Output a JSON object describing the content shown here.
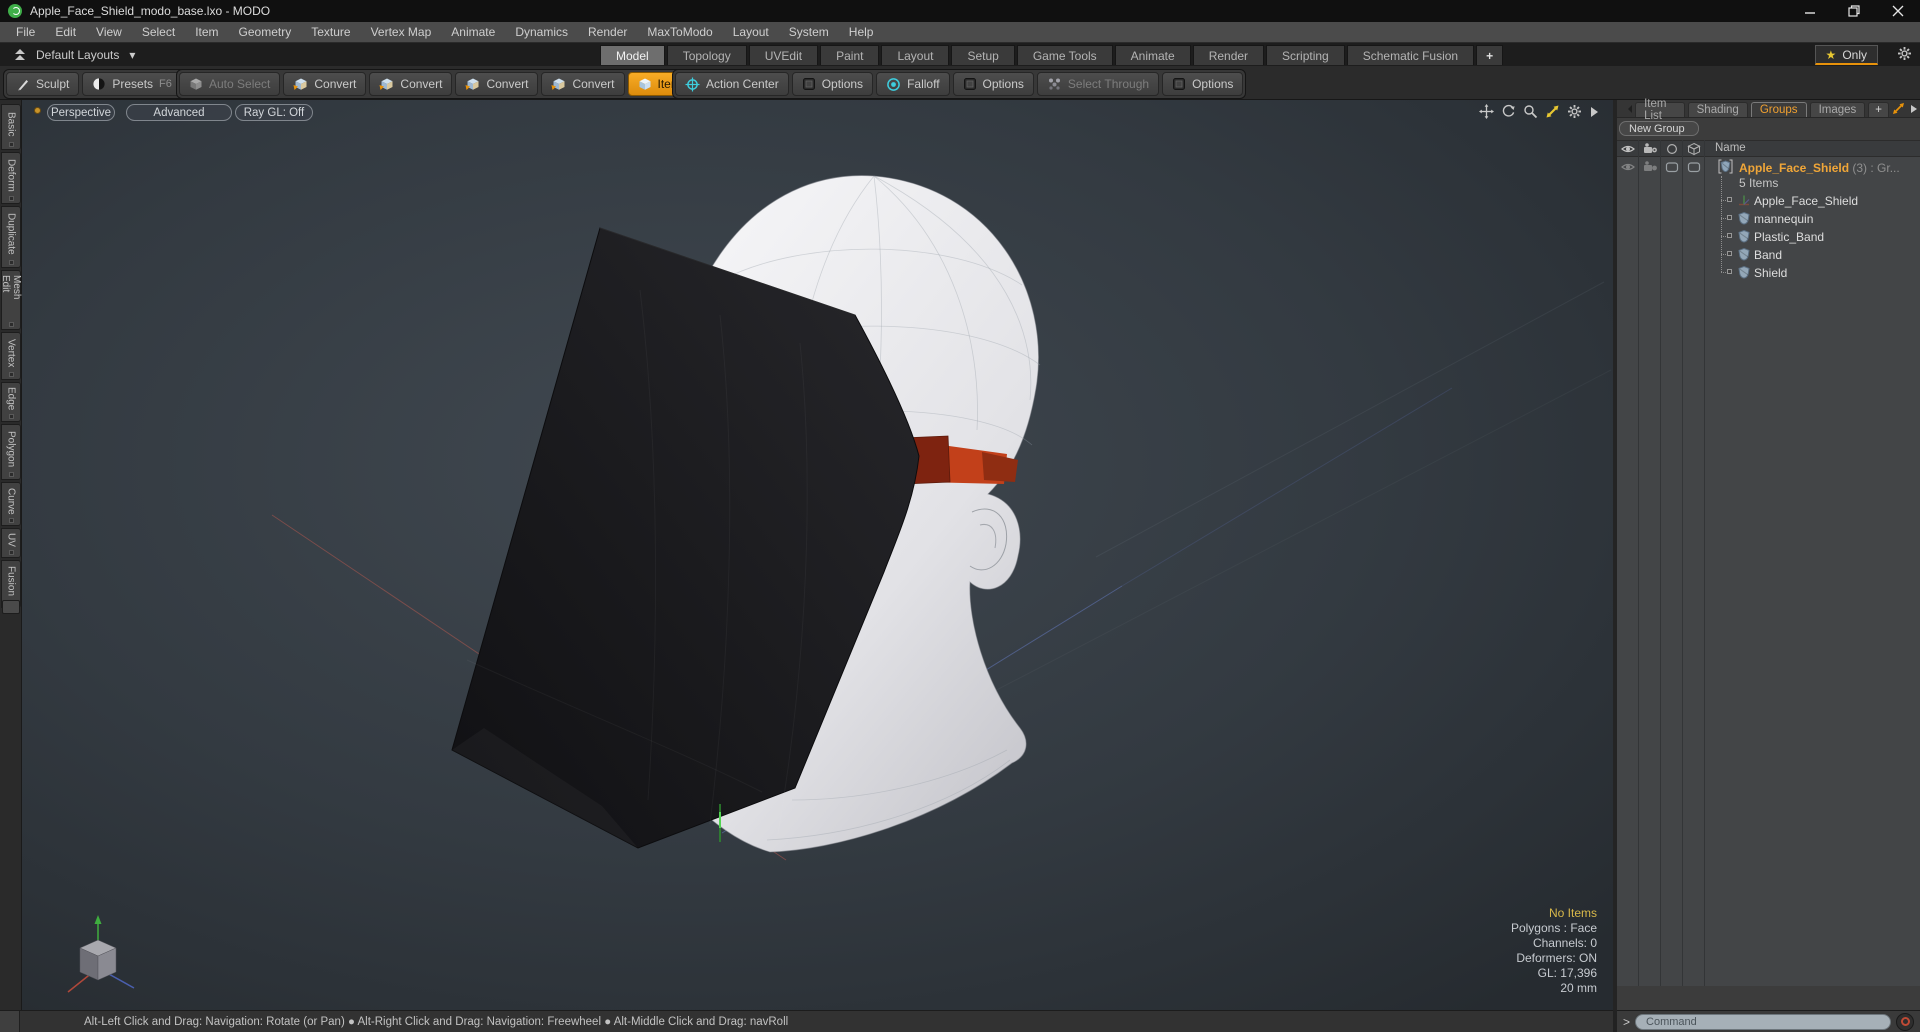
{
  "window": {
    "title": "Apple_Face_Shield_modo_base.lxo - MODO"
  },
  "menu": {
    "items": [
      "File",
      "Edit",
      "View",
      "Select",
      "Item",
      "Geometry",
      "Texture",
      "Vertex Map",
      "Animate",
      "Dynamics",
      "Render",
      "MaxToModo",
      "Layout",
      "System",
      "Help"
    ]
  },
  "layout_bar": {
    "layouts_label": "Default Layouts",
    "caret": "▾",
    "tabs": [
      "Model",
      "Topology",
      "UVEdit",
      "Paint",
      "Layout",
      "Setup",
      "Game Tools",
      "Animate",
      "Render",
      "Scripting",
      "Schematic Fusion"
    ],
    "add_tab": "+",
    "star": "★",
    "only_label": "Only"
  },
  "toolbar": {
    "sculpt": "Sculpt",
    "presets": "Presets",
    "presets_key": "F6",
    "auto_select": "Auto Select",
    "convert": "Convert",
    "items": "Items",
    "action_center": "Action Center",
    "options": "Options",
    "falloff": "Falloff",
    "select_through": "Select Through"
  },
  "left_tabs": {
    "items": [
      "Basic",
      "Deform",
      "Duplicate",
      "Mesh Edit",
      "Vertex",
      "Edge",
      "Polygon",
      "Curve",
      "UV",
      "Fusion"
    ]
  },
  "viewport": {
    "buttons": [
      "Perspective",
      "Advanced",
      "Ray GL: Off"
    ],
    "overlay": {
      "no_items": "No Items",
      "lines": [
        "Polygons : Face",
        "Channels: 0",
        "Deformers: ON",
        "GL: 17,396",
        "20 mm"
      ]
    }
  },
  "right_panel": {
    "tabs": [
      "Item List",
      "Shading",
      "Groups",
      "Images"
    ],
    "add_tab": "+",
    "new_group": "New Group",
    "name_header": "Name",
    "group": {
      "name": "Apple_Face_Shield",
      "suffix": "(3) : Gr...",
      "items_count": "5 Items"
    },
    "items": [
      "Apple_Face_Shield",
      "mannequin",
      "Plastic_Band",
      "Band",
      "Shield"
    ]
  },
  "command_bar": {
    "prompt": ">",
    "placeholder": "Command"
  },
  "status_bar": {
    "text": "Alt-Left Click and Drag: Navigation: Rotate (or Pan)  ●  Alt-Right Click and Drag: Navigation: Freewheel  ●  Alt-Middle Click and Drag: navRoll"
  },
  "colors": {
    "accent_orange": "#f0a030",
    "selected_button": "#f2a218",
    "band_red": "#c2401a",
    "star_yellow": "#e8c832",
    "viewport_bg": "#343b42"
  }
}
